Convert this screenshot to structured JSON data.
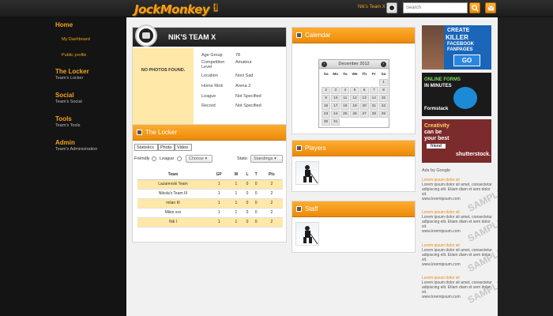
{
  "topbar": {
    "logo": "JockMonkey",
    "logo_tag": "beta",
    "team_link": "Nik's Team X",
    "search_placeholder": "Search"
  },
  "sidebar": {
    "home": "Home",
    "home_links": [
      "My Dashboard",
      "Public profile"
    ],
    "sections": [
      {
        "title": "The Locker",
        "sub": "Team's Locker"
      },
      {
        "title": "Social",
        "sub": "Team's Social"
      },
      {
        "title": "Tools",
        "sub": "Team's Tools"
      },
      {
        "title": "Admin",
        "sub": "Team's Administration"
      }
    ]
  },
  "profile": {
    "name": "NIK'S TEAM X",
    "no_photos": "NO PHOTOS FOUND.",
    "fields": [
      {
        "label": "Age Group",
        "value": "78"
      },
      {
        "label": "Competition Level",
        "value": "Amateur"
      },
      {
        "label": "Location",
        "value": "Novi Sad"
      },
      {
        "label": "Home Rink",
        "value": "Arena 2"
      },
      {
        "label": "League",
        "value": "Not Specified"
      },
      {
        "label": "Record",
        "value": "Not Specified"
      }
    ]
  },
  "locker": {
    "title": "The Locker",
    "tabs": [
      "Statistics",
      "Photo",
      "Video"
    ],
    "friendly_label": "Friendly",
    "league_label": "League",
    "choose_label": "Choose",
    "stats_label": "Stats:",
    "standings_label": "Standings",
    "columns": [
      "Team",
      "GP",
      "W",
      "L",
      "T",
      "Pts"
    ],
    "rows": [
      [
        "Lazarevski Team",
        "1",
        "1",
        "0",
        "0",
        "2"
      ],
      [
        "Nikola's Team III",
        "1",
        "1",
        "0",
        "0",
        "2"
      ],
      [
        "milan III",
        "1",
        "1",
        "0",
        "0",
        "2"
      ],
      [
        "Mikin xxx",
        "1",
        "1",
        "0",
        "0",
        "2"
      ],
      [
        "Nik I",
        "1",
        "1",
        "0",
        "0",
        "2"
      ]
    ]
  },
  "calendar": {
    "title": "Calendar",
    "month": "December 2012",
    "prev": "‹",
    "next": "›",
    "days": [
      "Sa",
      "Mo",
      "Tu",
      "We",
      "Th",
      "Fr",
      "Sa"
    ],
    "weeks": [
      [
        "",
        "",
        "",
        "",
        "",
        "",
        "1"
      ],
      [
        "2",
        "3",
        "4",
        "5",
        "6",
        "7",
        "8"
      ],
      [
        "9",
        "10",
        "11",
        "12",
        "13",
        "14",
        "15"
      ],
      [
        "16",
        "17",
        "18",
        "19",
        "20",
        "21",
        "22"
      ],
      [
        "23",
        "24",
        "25",
        "26",
        "27",
        "28",
        "29"
      ],
      [
        "30",
        "31",
        "",
        "",
        "",
        "",
        ""
      ]
    ]
  },
  "players": {
    "title": "Players"
  },
  "staff": {
    "title": "Staff"
  },
  "ads": {
    "ad1": {
      "line1": "CREATE",
      "line2": "KILLER",
      "line3": "FACEBOOK",
      "line4": "FANPAGES",
      "cta": "GO"
    },
    "ad2": {
      "line1": "ONLINE FORMS",
      "line2": "IN MINUTES",
      "brand": "Formstack"
    },
    "ad3": {
      "line1": "Creativity",
      "line2": "can be",
      "line3": "your best",
      "line4": "friend",
      "brand": "shutterstock."
    },
    "label": "Ads by Google",
    "entries": [
      {
        "title": "Lorem ipsum dolor sit",
        "body": "Lorem ipsum dolor sit amet, consectetur adipiscing elit. Etiam diam et sem dolor sit.",
        "url": "www.loremipsum.com"
      },
      {
        "title": "Lorem ipsum dolor sit",
        "body": "Lorem ipsum dolor sit amet, consectetur adipiscing elit. Etiam diam et sem dolor sit.",
        "url": "www.loremipsum.com"
      },
      {
        "title": "Lorem ipsum dolor sit",
        "body": "Lorem ipsum dolor sit amet, consectetur adipiscing elit. Etiam diam et sem dolor sit.",
        "url": "www.loremipsum.com"
      },
      {
        "title": "Lorem ipsum dolor sit",
        "body": "Lorem ipsum dolor sit amet, consectetur adipiscing elit. Etiam diam et sem dolor sit.",
        "url": "www.loremipsum.com"
      }
    ],
    "watermark": "SAMPLE"
  },
  "colors": {
    "accent": "#f4a118",
    "header": "#1c1c1c",
    "highlight_row": "#ffe8a8"
  }
}
